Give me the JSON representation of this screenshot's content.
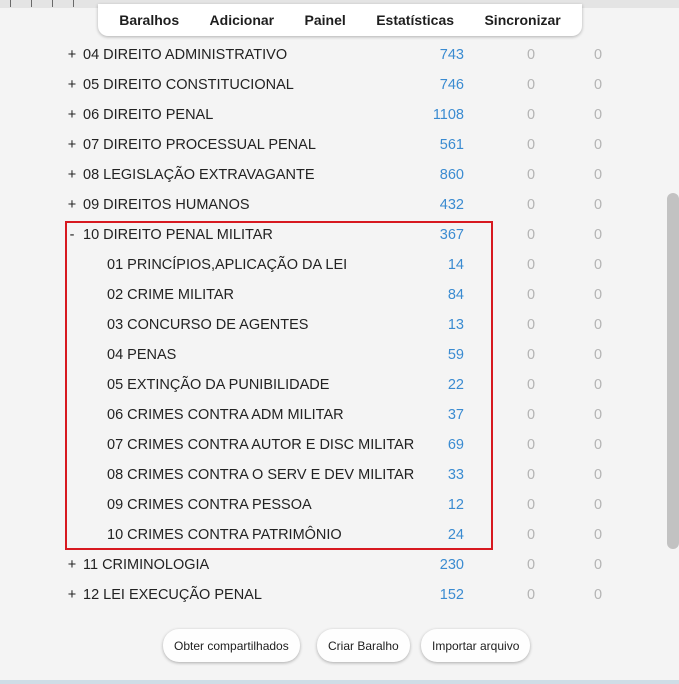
{
  "toolbar": {
    "items": [
      "Baralhos",
      "Adicionar",
      "Painel",
      "Estatísticas",
      "Sincronizar"
    ]
  },
  "decks": [
    {
      "expander": "+",
      "name": "04 DIREITO ADMINISTRATIVO",
      "new": "743",
      "learn": "0",
      "due": "0"
    },
    {
      "expander": "+",
      "name": "05 DIREITO CONSTITUCIONAL",
      "new": "746",
      "learn": "0",
      "due": "0"
    },
    {
      "expander": "+",
      "name": "06 DIREITO PENAL",
      "new": "1108",
      "learn": "0",
      "due": "0"
    },
    {
      "expander": "+",
      "name": "07 DIREITO PROCESSUAL PENAL",
      "new": "561",
      "learn": "0",
      "due": "0"
    },
    {
      "expander": "+",
      "name": "08 LEGISLAÇÃO EXTRAVAGANTE",
      "new": "860",
      "learn": "0",
      "due": "0"
    },
    {
      "expander": "+",
      "name": "09 DIREITOS HUMANOS",
      "new": "432",
      "learn": "0",
      "due": "0"
    },
    {
      "expander": "-",
      "name": "10 DIREITO PENAL MILITAR",
      "new": "367",
      "learn": "0",
      "due": "0"
    },
    {
      "expander": "",
      "name": "01 PRINCÍPIOS,APLICAÇÃO DA LEI",
      "new": "14",
      "learn": "0",
      "due": "0"
    },
    {
      "expander": "",
      "name": "02 CRIME MILITAR",
      "new": "84",
      "learn": "0",
      "due": "0"
    },
    {
      "expander": "",
      "name": "03 CONCURSO DE AGENTES",
      "new": "13",
      "learn": "0",
      "due": "0"
    },
    {
      "expander": "",
      "name": "04 PENAS",
      "new": "59",
      "learn": "0",
      "due": "0"
    },
    {
      "expander": "",
      "name": "05 EXTINÇÃO DA PUNIBILIDADE",
      "new": "22",
      "learn": "0",
      "due": "0"
    },
    {
      "expander": "",
      "name": "06 CRIMES CONTRA ADM MILITAR",
      "new": "37",
      "learn": "0",
      "due": "0"
    },
    {
      "expander": "",
      "name": "07 CRIMES CONTRA AUTOR E DISC MILITAR",
      "new": "69",
      "learn": "0",
      "due": "0"
    },
    {
      "expander": "",
      "name": "08 CRIMES CONTRA O SERV E DEV MILITAR",
      "new": "33",
      "learn": "0",
      "due": "0"
    },
    {
      "expander": "",
      "name": "09 CRIMES CONTRA PESSOA",
      "new": "12",
      "learn": "0",
      "due": "0"
    },
    {
      "expander": "",
      "name": "10 CRIMES CONTRA PATRIMÔNIO",
      "new": "24",
      "learn": "0",
      "due": "0"
    },
    {
      "expander": "+",
      "name": "11 CRIMINOLOGIA",
      "new": "230",
      "learn": "0",
      "due": "0"
    },
    {
      "expander": "+",
      "name": "12 LEI EXECUÇÃO PENAL",
      "new": "152",
      "learn": "0",
      "due": "0"
    }
  ],
  "bottom_buttons": [
    "Obter compartilhados",
    "Criar Baralho",
    "Importar arquivo"
  ],
  "colors": {
    "new_count": "#3a8bd1",
    "zero_count": "#b4b4b4",
    "highlight": "#d71920",
    "background": "#f4f4f4"
  }
}
